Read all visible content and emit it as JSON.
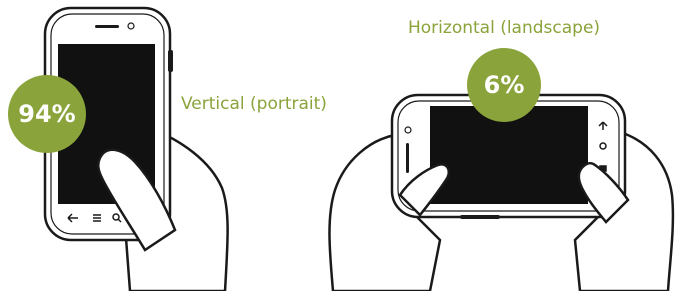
{
  "portrait": {
    "label": "Vertical (portrait)",
    "percent": "94%",
    "share": 0.94
  },
  "landscape": {
    "label": "Horizontal (landscape)",
    "percent": "6%",
    "share": 0.06
  },
  "colors": {
    "accent": "#8aa33a",
    "screen": "#111111",
    "outline": "#1a1a1a",
    "background": "#ffffff"
  },
  "icons": [
    "back-icon",
    "menu-icon",
    "search-icon",
    "mic-icon"
  ]
}
